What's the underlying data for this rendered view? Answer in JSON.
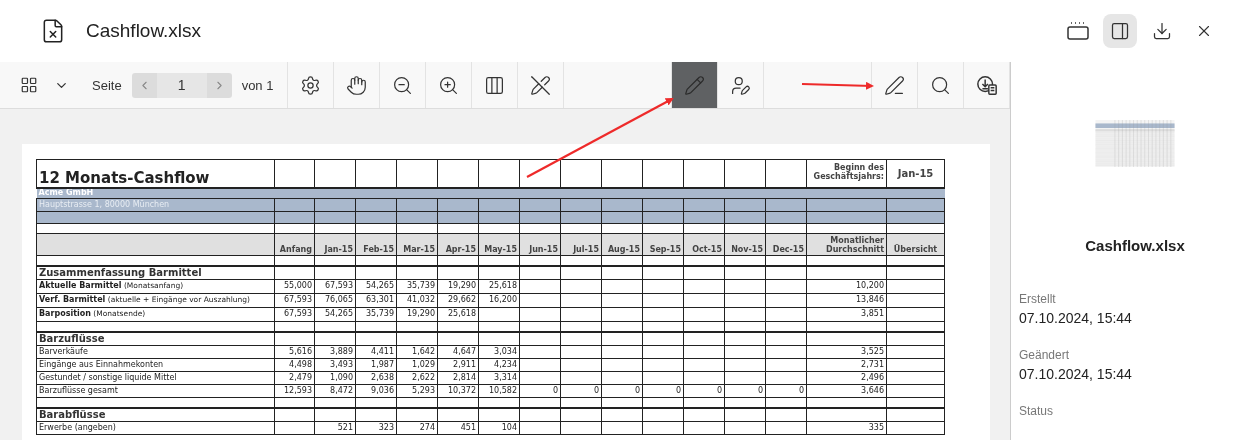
{
  "header": {
    "title": "Cashflow.xlsx",
    "actions": [
      {
        "kind": "tabs",
        "selected": false
      },
      {
        "kind": "sidebar",
        "selected": true
      },
      {
        "kind": "download",
        "selected": false
      },
      {
        "kind": "close",
        "selected": false
      }
    ]
  },
  "toolbar": {
    "page_label": "Seite",
    "page_value": "1",
    "page_total": "von 1",
    "tool_groups": [
      [
        {
          "kind": "settings",
          "selected": false
        },
        {
          "kind": "hand",
          "selected": false
        },
        {
          "kind": "zoom-out",
          "selected": false
        },
        {
          "kind": "zoom-in",
          "selected": false
        },
        {
          "kind": "columns",
          "selected": false
        },
        {
          "kind": "pen-off",
          "selected": false
        }
      ],
      [
        {
          "kind": "pencil",
          "selected": true
        },
        {
          "kind": "user-pen",
          "selected": false
        }
      ],
      [
        {
          "kind": "pen-line",
          "selected": false
        },
        {
          "kind": "search",
          "selected": false
        },
        {
          "kind": "download-doc",
          "selected": false
        }
      ]
    ]
  },
  "document": {
    "rows": [
      {
        "kind": "title",
        "label": "12 Monats-Cashflow",
        "cells": [
          null,
          null,
          null,
          null,
          null,
          null,
          null,
          null,
          null,
          null,
          null,
          null,
          null,
          "Beginn des Geschäftsjahrs:",
          "Jan-15"
        ]
      },
      {
        "kind": "company",
        "label": "Acme GmbH"
      },
      {
        "kind": "address",
        "label": "Hauptstrasse 1, 80000 München"
      },
      {
        "kind": "band"
      },
      {
        "kind": "blank"
      },
      {
        "kind": "header",
        "cells": [
          "Anfang",
          "Jan-15",
          "Feb-15",
          "Mar-15",
          "Apr-15",
          "May-15",
          "Jun-15",
          "Jul-15",
          "Aug-15",
          "Sep-15",
          "Oct-15",
          "Nov-15",
          "Dec-15",
          "Monatlicher Durchschnitt",
          "Übersicht"
        ]
      },
      {
        "kind": "blank"
      },
      {
        "kind": "section",
        "label": "Zusammenfassung Barmittel"
      },
      {
        "kind": "data",
        "emphasis": true,
        "label": "Aktuelle Barmittel",
        "note": "(Monatsanfang)",
        "cells": [
          "55,000",
          "67,593",
          "54,265",
          "35,739",
          "19,290",
          "25,618",
          null,
          null,
          null,
          null,
          null,
          null,
          null,
          "10,200",
          null
        ]
      },
      {
        "kind": "data",
        "emphasis": true,
        "label": "Verf. Barmittel",
        "note": "(aktuelle + Eingänge vor Auszahlung)",
        "cells": [
          "67,593",
          "76,065",
          "63,301",
          "41,032",
          "29,662",
          "16,200",
          null,
          null,
          null,
          null,
          null,
          null,
          null,
          "13,846",
          null
        ]
      },
      {
        "kind": "data",
        "emphasis": true,
        "label": "Barposition",
        "note": "(Monatsende)",
        "cells": [
          "67,593",
          "54,265",
          "35,739",
          "19,290",
          "25,618",
          null,
          null,
          null,
          null,
          null,
          null,
          null,
          null,
          "3,851",
          null
        ]
      },
      {
        "kind": "blank"
      },
      {
        "kind": "section",
        "label": "Barzuflüsse"
      },
      {
        "kind": "data",
        "emphasis": false,
        "label": "Barverkäufe",
        "cells": [
          "5,616",
          "3,889",
          "4,411",
          "1,642",
          "4,647",
          "3,034",
          null,
          null,
          null,
          null,
          null,
          null,
          null,
          "3,525",
          null
        ]
      },
      {
        "kind": "data",
        "emphasis": false,
        "label": "Eingänge aus Einnahmekonten",
        "cells": [
          "4,498",
          "3,493",
          "1,987",
          "1,029",
          "2,911",
          "4,234",
          null,
          null,
          null,
          null,
          null,
          null,
          null,
          "2,731",
          null
        ]
      },
      {
        "kind": "data",
        "emphasis": false,
        "label": "Gestundet / sonstige liquide Mittel",
        "cells": [
          "2,479",
          "1,090",
          "2,638",
          "2,622",
          "2,814",
          "3,314",
          null,
          null,
          null,
          null,
          null,
          null,
          null,
          "2,496",
          null
        ]
      },
      {
        "kind": "data",
        "emphasis": false,
        "label": "Barzuflüsse gesamt",
        "cells": [
          "12,593",
          "8,472",
          "9,036",
          "5,293",
          "10,372",
          "10,582",
          "0",
          "0",
          "0",
          "0",
          "0",
          "0",
          "0",
          "3,646",
          null
        ]
      },
      {
        "kind": "blank"
      },
      {
        "kind": "section",
        "label": "Barabflüsse"
      },
      {
        "kind": "data",
        "emphasis": false,
        "label": "Erwerbe (angeben)",
        "cells": [
          null,
          "521",
          "323",
          "274",
          "451",
          "104",
          null,
          null,
          null,
          null,
          null,
          null,
          null,
          "335",
          null
        ]
      }
    ]
  },
  "sidebar": {
    "title": "Cashflow.xlsx",
    "fields": [
      {
        "label": "Erstellt",
        "value": "07.10.2024, 15:44"
      },
      {
        "label": "Geändert",
        "value": "07.10.2024, 15:44"
      },
      {
        "label": "Status"
      }
    ]
  }
}
